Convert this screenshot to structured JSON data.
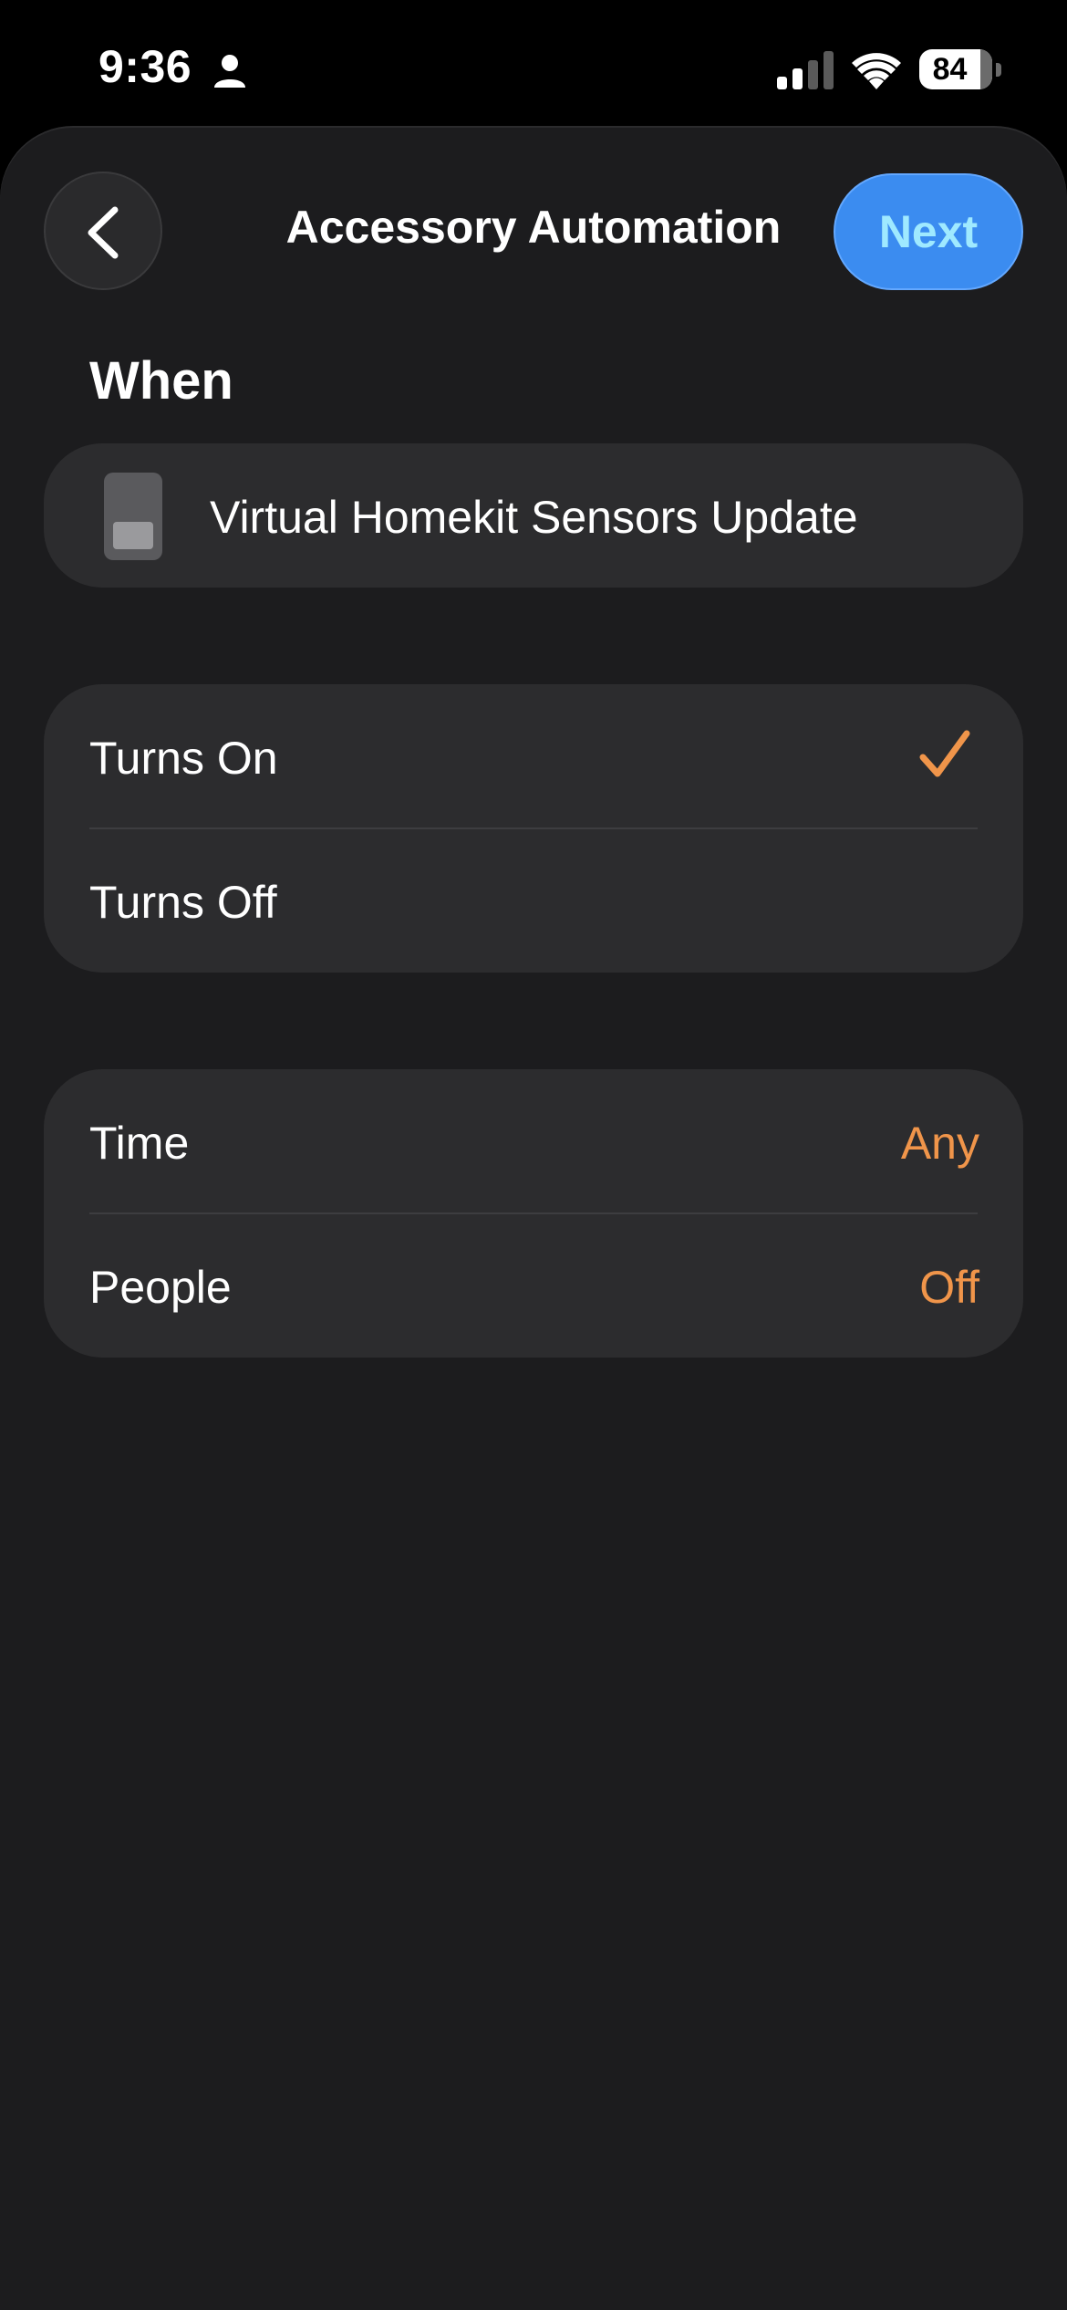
{
  "status_bar": {
    "time": "9:36",
    "battery_percent": "84",
    "icons": [
      "person-icon",
      "signal-icon",
      "wifi-icon",
      "battery-icon"
    ]
  },
  "nav": {
    "title": "Accessory Automation",
    "next_label": "Next",
    "back_icon": "chevron-left-icon"
  },
  "section": {
    "heading": "When"
  },
  "accessory": {
    "name": "Virtual Homekit Sensors Update",
    "icon": "switch-icon"
  },
  "trigger_states": [
    {
      "label": "Turns On",
      "selected": true
    },
    {
      "label": "Turns Off",
      "selected": false
    }
  ],
  "options": [
    {
      "label": "Time",
      "value": "Any"
    },
    {
      "label": "People",
      "value": "Off"
    }
  ],
  "colors": {
    "background": "#1c1c1e",
    "card": "#2c2c2e",
    "accent": "#f0954a",
    "next_button": "#3b8cf0",
    "next_text": "#9fe9ff"
  }
}
